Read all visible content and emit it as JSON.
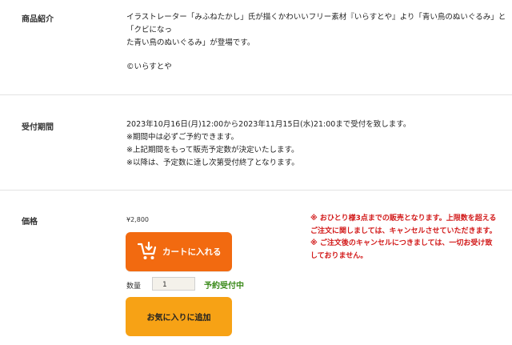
{
  "product_intro": {
    "label": "商品紹介",
    "paragraph_line1": "イラストレーター「みふねたかし」氏が描くかわいいフリー素材『いらすとや』より「青い鳥のぬいぐるみ」と「クビになっ",
    "paragraph_line2": "た青い鳥のぬいぐるみ」が登場です。",
    "copyright": "©いらすとや"
  },
  "reception_period": {
    "label": "受付期間",
    "lines": [
      "2023年10月16日(月)12:00から2023年11月15日(水)21:00まで受付を致します。",
      "※期間中は必ずご予約できます。",
      "※上記期間をもって販売予定数が決定いたします。",
      "※以降は、予定数に達し次第受付終了となります。"
    ]
  },
  "pricing": {
    "label": "価格",
    "price": "¥2,800",
    "cart_button_label": "カートに入れる",
    "quantity_label": "数量",
    "quantity_value": "1",
    "status": "予約受付中",
    "favorite_button_label": "お気に入りに追加",
    "notices": [
      "※ おひとり様3点までの販売となります。上限数を超える",
      "ご注文に関しましては、キャンセルさせていただきます。",
      "※ ご注文後のキャンセルにつきましては、一切お受け致",
      "しておりません。"
    ]
  },
  "colors": {
    "cart_button": "#f26a10",
    "favorite_button": "#f7a215",
    "status_green": "#3a8a1a",
    "notice_red": "#d21a1a"
  },
  "icons": {
    "cart": "cart-add-icon"
  }
}
